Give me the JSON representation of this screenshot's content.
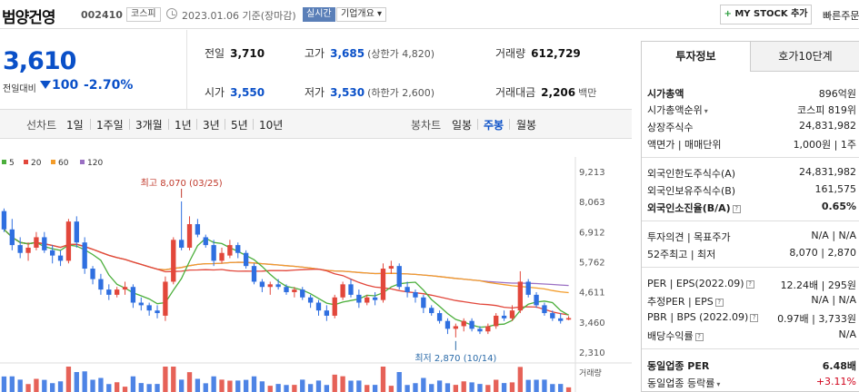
{
  "header": {
    "name": "범양건영",
    "code": "002410",
    "market": "코스피",
    "date": "2023.01.06",
    "basis": "기준(장마감)",
    "live": "실시간",
    "company_info": "기업개요",
    "my_stock": "MY STOCK 추가",
    "quick": "빠른주문"
  },
  "quote": {
    "price": "3,610",
    "change_label": "전일대비",
    "change": "100",
    "change_pct": "-2.70%",
    "prev_close_label": "전일",
    "prev_close": "3,710",
    "open_label": "시가",
    "open": "3,550",
    "high_label": "고가",
    "high": "3,685",
    "upper_limit": "(상한가 4,820)",
    "low_label": "저가",
    "low": "3,530",
    "lower_limit": "(하한가 2,600)",
    "volume_label": "거래량",
    "volume": "612,729",
    "value_label": "거래대금",
    "value": "2,206",
    "value_unit": "백만"
  },
  "tabs": {
    "line_chart": "선차트",
    "periods": [
      "1일",
      "1주일",
      "3개월",
      "1년",
      "3년",
      "5년",
      "10년"
    ],
    "candle_chart": "봉차트",
    "candle_types": [
      "일봉",
      "주봉",
      "월봉"
    ],
    "active_candle": "주봉"
  },
  "chart_data": {
    "type": "candlestick",
    "ma_legend": [
      {
        "label": "5",
        "color": "#4caf3c"
      },
      {
        "label": "20",
        "color": "#e2473b"
      },
      {
        "label": "60",
        "color": "#f39c2a"
      },
      {
        "label": "120",
        "color": "#9a6fc3"
      }
    ],
    "yticks": [
      "9,213",
      "8,063",
      "6,912",
      "5,762",
      "4,611",
      "3,460",
      "2,310"
    ],
    "ylim": [
      2310,
      9213
    ],
    "up_color": "#e2473b",
    "down_color": "#2f6fe0",
    "annotations": {
      "high": "최고 8,070 (03/25)",
      "low": "최저 2,870 (10/14)"
    },
    "volume_label": "거래량",
    "candles": [
      [
        7700,
        7800,
        6900,
        7000
      ],
      [
        7000,
        7400,
        6200,
        6400
      ],
      [
        6400,
        6700,
        5900,
        6100
      ],
      [
        6100,
        6500,
        5800,
        6300
      ],
      [
        6300,
        6900,
        6200,
        6700
      ],
      [
        6700,
        6900,
        6100,
        6200
      ],
      [
        6200,
        6400,
        5700,
        6000
      ],
      [
        6000,
        6200,
        5600,
        5800
      ],
      [
        5800,
        7400,
        5700,
        7300
      ],
      [
        7300,
        7500,
        6300,
        6500
      ],
      [
        6500,
        6700,
        5300,
        5500
      ],
      [
        5500,
        5600,
        4900,
        5100
      ],
      [
        5100,
        5300,
        4500,
        4700
      ],
      [
        4700,
        4900,
        4300,
        4500
      ],
      [
        4500,
        4800,
        4400,
        4700
      ],
      [
        4700,
        5000,
        4500,
        4800
      ],
      [
        4800,
        4900,
        4000,
        4200
      ],
      [
        4200,
        4400,
        3900,
        4100
      ],
      [
        4100,
        4200,
        3700,
        3900
      ],
      [
        3900,
        4100,
        3600,
        3800
      ],
      [
        3700,
        5200,
        3500,
        5000
      ],
      [
        5000,
        6700,
        4900,
        6600
      ],
      [
        6600,
        8070,
        6200,
        6300
      ],
      [
        6300,
        7500,
        6200,
        7200
      ],
      [
        7200,
        7400,
        6700,
        6800
      ],
      [
        6700,
        6800,
        6300,
        6400
      ],
      [
        6400,
        6600,
        5600,
        5800
      ],
      [
        5800,
        6300,
        5700,
        6100
      ],
      [
        6000,
        6600,
        5900,
        6400
      ],
      [
        6400,
        6500,
        5900,
        6100
      ],
      [
        6100,
        6200,
        5500,
        5600
      ],
      [
        5600,
        5700,
        4900,
        5000
      ],
      [
        5000,
        5100,
        4600,
        4800
      ],
      [
        4800,
        5000,
        4500,
        4900
      ],
      [
        4900,
        5100,
        4700,
        4800
      ],
      [
        4800,
        4900,
        4500,
        4600
      ],
      [
        4600,
        4800,
        4400,
        4700
      ],
      [
        4700,
        4800,
        4300,
        4400
      ],
      [
        4400,
        4500,
        4000,
        4200
      ],
      [
        4200,
        4300,
        3700,
        3900
      ],
      [
        3900,
        4100,
        3500,
        3700
      ],
      [
        3700,
        4500,
        3600,
        4400
      ],
      [
        4400,
        5000,
        4300,
        4900
      ],
      [
        4900,
        5100,
        4400,
        4500
      ],
      [
        4500,
        4700,
        4000,
        4200
      ],
      [
        4200,
        4500,
        4100,
        4400
      ],
      [
        4400,
        4600,
        4100,
        4300
      ],
      [
        4300,
        5700,
        4200,
        5500
      ],
      [
        5500,
        5800,
        5300,
        5600
      ],
      [
        5600,
        5700,
        4700,
        4800
      ],
      [
        4800,
        5000,
        4400,
        4600
      ],
      [
        4600,
        4700,
        4200,
        4400
      ],
      [
        4400,
        4500,
        3800,
        4000
      ],
      [
        4000,
        4100,
        3700,
        3800
      ],
      [
        3800,
        3900,
        3400,
        3500
      ],
      [
        3500,
        3600,
        3000,
        3200
      ],
      [
        3200,
        3400,
        2870,
        3300
      ],
      [
        3300,
        3600,
        3100,
        3500
      ],
      [
        3500,
        3600,
        3100,
        3200
      ],
      [
        3200,
        3300,
        3000,
        3100
      ],
      [
        3100,
        3400,
        3000,
        3300
      ],
      [
        3300,
        3800,
        3200,
        3700
      ],
      [
        3700,
        3900,
        3500,
        3600
      ],
      [
        3600,
        4100,
        3500,
        3900
      ],
      [
        3900,
        5400,
        3800,
        5000
      ],
      [
        5000,
        5100,
        4400,
        4500
      ],
      [
        4500,
        4600,
        4000,
        4100
      ],
      [
        4100,
        4200,
        3700,
        3800
      ],
      [
        3800,
        3900,
        3500,
        3600
      ],
      [
        3600,
        3800,
        3400,
        3500
      ],
      [
        3550,
        3685,
        3530,
        3610
      ]
    ]
  },
  "panel": {
    "tab_invest": "투자정보",
    "tab_orderbook": "호가10단계",
    "market_cap_label": "시가총액",
    "market_cap": "896억원",
    "cap_rank_label": "시가총액순위",
    "cap_rank": "코스피 819위",
    "shares_label": "상장주식수",
    "shares": "24,831,982",
    "par_label": "액면가 | 매매단위",
    "par": "1,000원 | 1주",
    "foreign_limit_label": "외국인한도주식수(A)",
    "foreign_limit": "24,831,982",
    "foreign_hold_label": "외국인보유주식수(B)",
    "foreign_hold": "161,575",
    "foreign_ratio_label": "외국인소진율(B/A)",
    "foreign_ratio": "0.65%",
    "opinion_label": "투자의견 | 목표주가",
    "opinion": "N/A | N/A",
    "week52_label": "52주최고 | 최저",
    "week52": "8,070 | 2,870",
    "per_label": "PER | EPS(2022.09)",
    "per": "12.24배 | 295원",
    "est_per_label": "추정PER | EPS",
    "est_per": "N/A | N/A",
    "pbr_label": "PBR | BPS (2022.09)",
    "pbr": "0.97배 | 3,733원",
    "dividend_label": "배당수익률",
    "dividend": "N/A",
    "industry_per_label": "동일업종 PER",
    "industry_per": "6.48배",
    "industry_rate_label": "동일업종 등락률",
    "industry_rate": "+3.11%"
  }
}
